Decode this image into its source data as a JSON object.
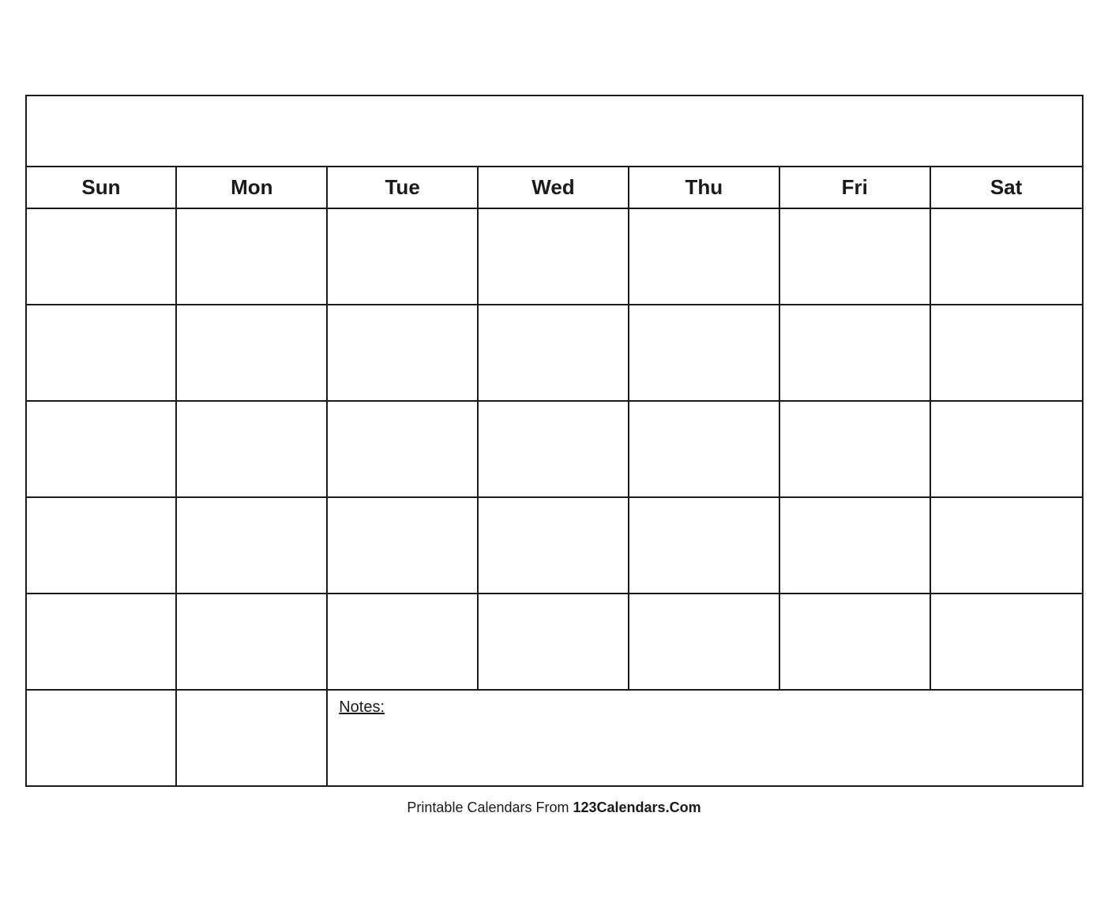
{
  "calendar": {
    "title": "",
    "header": {
      "days": [
        "Sun",
        "Mon",
        "Tue",
        "Wed",
        "Thu",
        "Fri",
        "Sat"
      ]
    },
    "weeks": [
      {
        "cells": [
          "",
          "",
          "",
          "",
          "",
          "",
          ""
        ]
      },
      {
        "cells": [
          "",
          "",
          "",
          "",
          "",
          "",
          ""
        ]
      },
      {
        "cells": [
          "",
          "",
          "",
          "",
          "",
          "",
          ""
        ]
      },
      {
        "cells": [
          "",
          "",
          "",
          "",
          "",
          "",
          ""
        ]
      },
      {
        "cells": [
          "",
          "",
          "",
          "",
          "",
          "",
          ""
        ]
      }
    ],
    "notes_label": "Notes:"
  },
  "footer": {
    "text": "Printable Calendars From ",
    "brand": "123Calendars.Com"
  }
}
